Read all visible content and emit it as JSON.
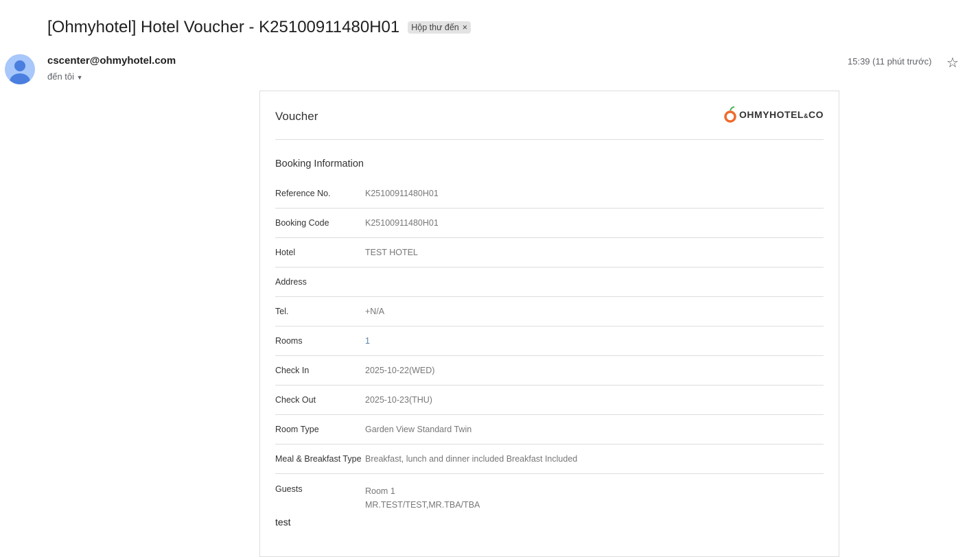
{
  "email": {
    "subject": "[Ohmyhotel] Hotel Voucher - K25100911480H01",
    "label": "Hộp thư đến",
    "sender": "cscenter@ohmyhotel.com",
    "to": "đến tôi",
    "time": "15:39 (11 phút trước)"
  },
  "voucher": {
    "title": "Voucher",
    "logo": "OHMYHOTEL&CO",
    "section": "Booking Information",
    "rows": [
      {
        "label": "Reference No.",
        "value": "K25100911480H01"
      },
      {
        "label": "Booking Code",
        "value": "K25100911480H01"
      },
      {
        "label": "Hotel",
        "value": "TEST HOTEL"
      },
      {
        "label": "Address",
        "value": ""
      },
      {
        "label": "Tel.",
        "value": "+N/A"
      },
      {
        "label": "Rooms",
        "value": "1"
      },
      {
        "label": "Check In",
        "value": "2025-10-22(WED)"
      },
      {
        "label": "Check Out",
        "value": "2025-10-23(THU)"
      },
      {
        "label": "Room Type",
        "value": "Garden View Standard Twin"
      },
      {
        "label": "Meal & Breakfast Type",
        "value": "Breakfast, lunch and dinner included Breakfast Included"
      },
      {
        "label": "Guests",
        "value": "Room 1",
        "value2": "MR.TEST/TEST,MR.TBA/TBA"
      }
    ],
    "note": "test"
  }
}
